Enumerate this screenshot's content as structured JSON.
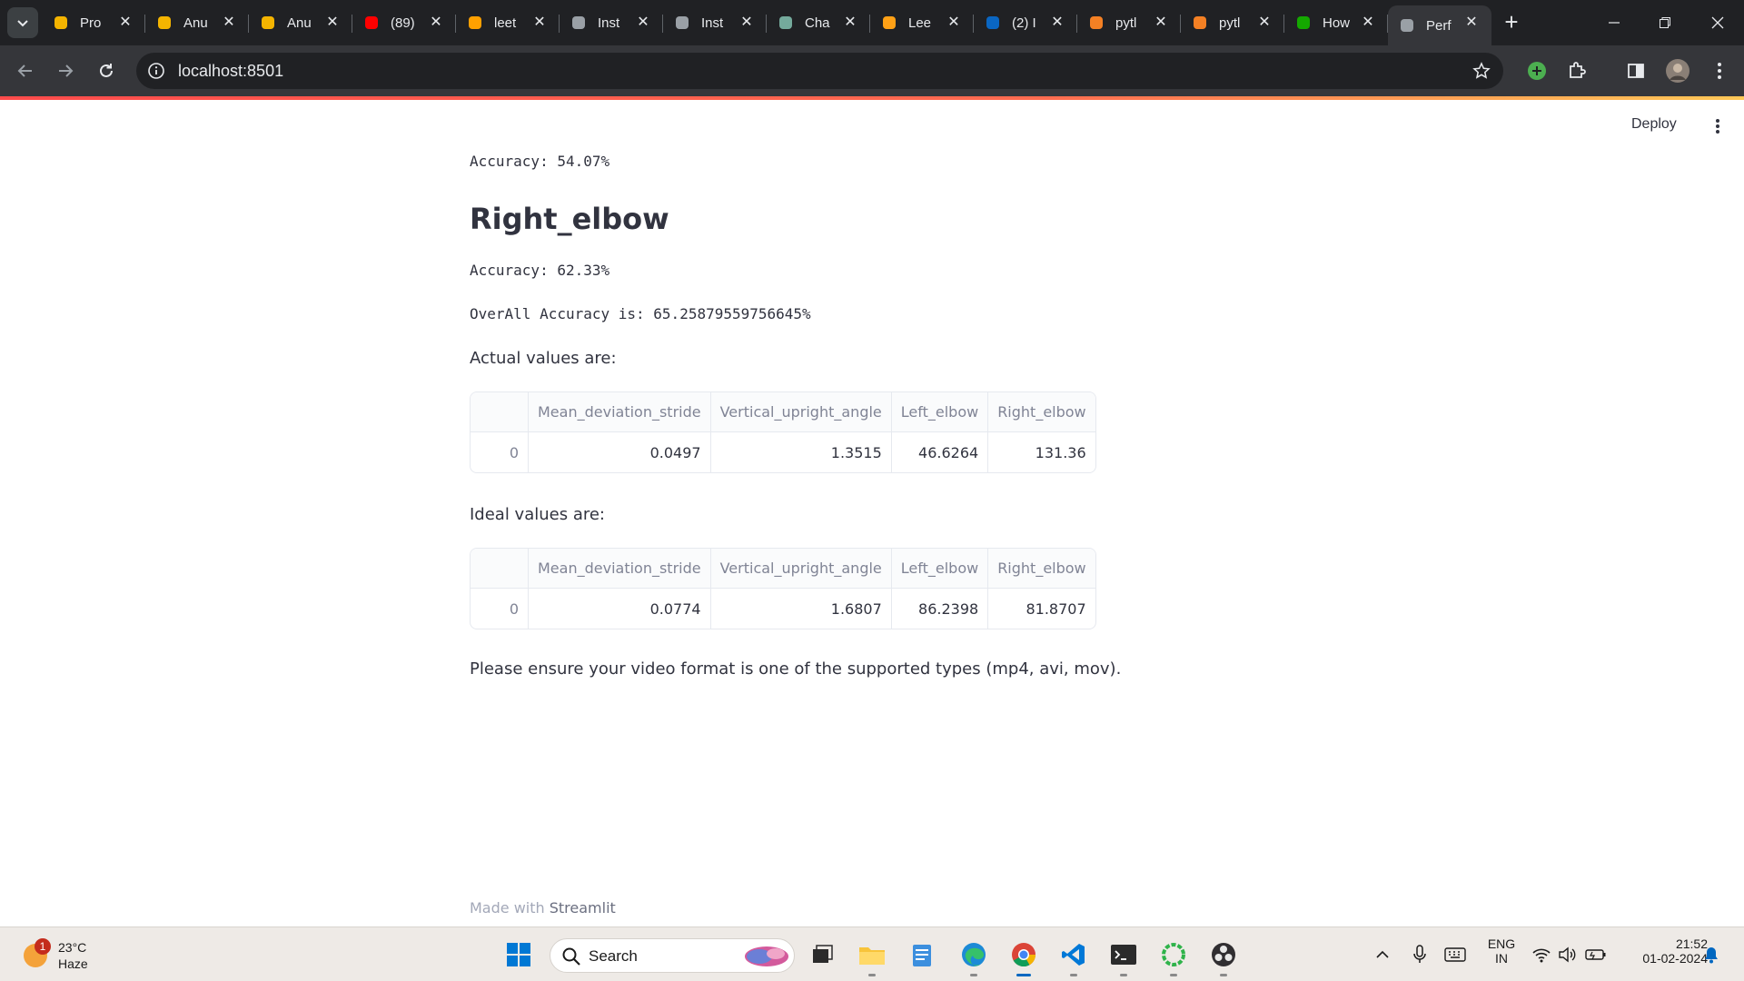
{
  "browser": {
    "tabs": [
      {
        "title": "Pro",
        "icon": "bar-chart-icon",
        "color": "#f4b400"
      },
      {
        "title": "Anu",
        "icon": "bar-chart-icon",
        "color": "#f4b400"
      },
      {
        "title": "Anu",
        "icon": "bar-chart-icon",
        "color": "#f4b400"
      },
      {
        "title": "(89)",
        "icon": "youtube-icon",
        "color": "#ff0000"
      },
      {
        "title": "leet",
        "icon": "firebase-icon",
        "color": "#ffa000"
      },
      {
        "title": "Inst",
        "icon": "swirl-icon",
        "color": "#9aa0a6"
      },
      {
        "title": "Inst",
        "icon": "swirl-icon",
        "color": "#9aa0a6"
      },
      {
        "title": "Cha",
        "icon": "chatgpt-icon",
        "color": "#74aa9c"
      },
      {
        "title": "Lee",
        "icon": "leetcode-icon",
        "color": "#ffa116"
      },
      {
        "title": "(2) I",
        "icon": "linkedin-icon",
        "color": "#0a66c2"
      },
      {
        "title": "pytl",
        "icon": "stackoverflow-icon",
        "color": "#f48024"
      },
      {
        "title": "pytl",
        "icon": "stackoverflow-icon",
        "color": "#f48024"
      },
      {
        "title": "How",
        "icon": "upwork-icon",
        "color": "#14a800"
      },
      {
        "title": "Perf",
        "icon": "loading-icon",
        "color": "#9aa0a6"
      }
    ],
    "url": "localhost:8501"
  },
  "header": {
    "deploy_label": "Deploy"
  },
  "main": {
    "left_elbow_accuracy": "Accuracy: 54.07%",
    "right_elbow_heading": "Right_elbow",
    "right_elbow_accuracy": "Accuracy: 62.33%",
    "overall_accuracy": "OverAll Accuracy is: 65.25879559756645%",
    "actual_label": "Actual values are:",
    "ideal_label": "Ideal values are:",
    "columns": [
      "",
      "Mean_deviation_stride",
      "Vertical_upright_angle",
      "Left_elbow",
      "Right_elbow"
    ],
    "actual_row": [
      "0",
      "0.0497",
      "1.3515",
      "46.6264",
      "131.36"
    ],
    "ideal_row": [
      "0",
      "0.0774",
      "1.6807",
      "86.2398",
      "81.8707"
    ],
    "format_note": "Please ensure your video format is one of the supported types (mp4, avi, mov)."
  },
  "footer": {
    "made_with": "Made with",
    "brand": "Streamlit"
  },
  "taskbar": {
    "weather_badge": "1",
    "temperature": "23°C",
    "condition": "Haze",
    "search_label": "Search",
    "language_line1": "ENG",
    "language_line2": "IN",
    "time": "21:52",
    "date": "01-02-2024"
  }
}
